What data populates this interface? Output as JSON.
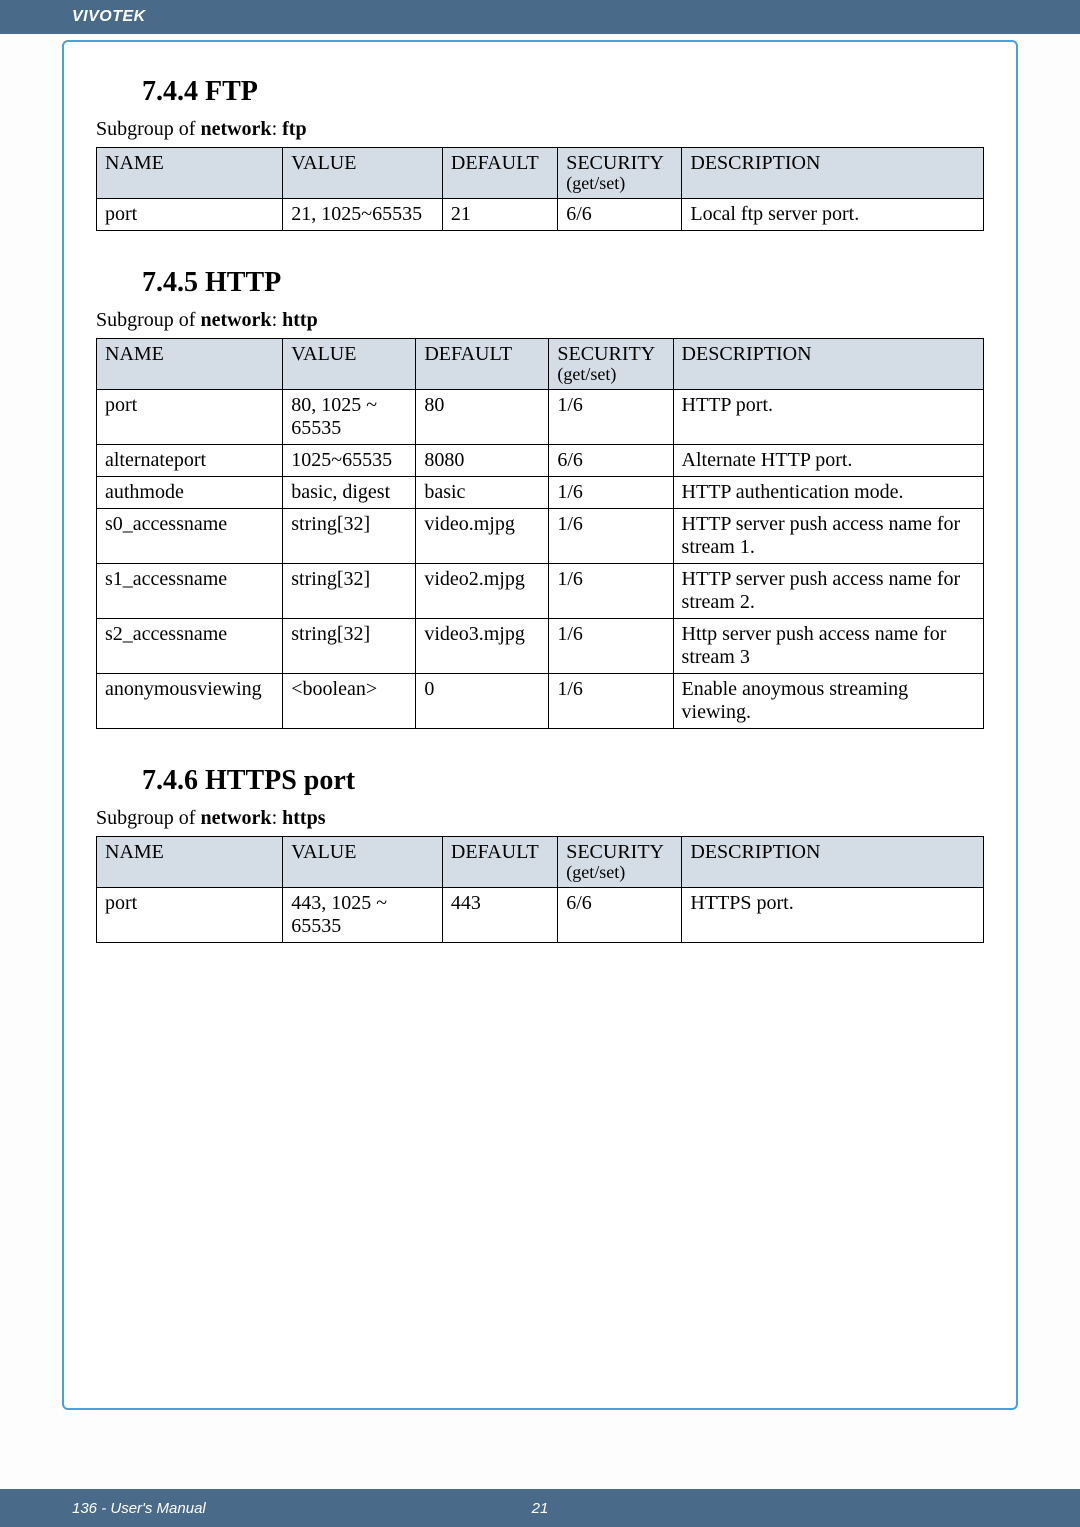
{
  "brand": "VIVOTEK",
  "footer_text": "136 - User's Manual",
  "page_number": "21",
  "ftp": {
    "title": "7.4.4 FTP",
    "subgroup_prefix": "Subgroup of ",
    "subgroup_bold1": "network",
    "subgroup_mid": ": ",
    "subgroup_bold2": "ftp",
    "headers": {
      "name": "NAME",
      "value": "VALUE",
      "default": "DEFAULT",
      "security": "SECURITY",
      "security_sub": "(get/set)",
      "description": "DESCRIPTION"
    },
    "rows": [
      {
        "name": "port",
        "value": "21, 1025~65535",
        "default": "21",
        "security": "6/6",
        "desc": "Local ftp server port."
      }
    ]
  },
  "http": {
    "title": "7.4.5 HTTP",
    "subgroup_prefix": "Subgroup of ",
    "subgroup_bold1": "network",
    "subgroup_mid": ": ",
    "subgroup_bold2": "http",
    "headers": {
      "name": "NAME",
      "value": "VALUE",
      "default": "DEFAULT",
      "security": "SECURITY",
      "security_sub": "(get/set)",
      "description": "DESCRIPTION"
    },
    "rows": [
      {
        "name": "port",
        "value": "80, 1025 ~ 65535",
        "default": "80",
        "security": "1/6",
        "desc": "HTTP port."
      },
      {
        "name": "alternateport",
        "value": "1025~65535",
        "default": "8080",
        "security": "6/6",
        "desc": "Alternate HTTP port."
      },
      {
        "name": "authmode",
        "value": "basic, digest",
        "default": "basic",
        "security": "1/6",
        "desc": "HTTP authentication mode."
      },
      {
        "name": "s0_accessname",
        "value": "string[32]",
        "default": "video.mjpg",
        "security": "1/6",
        "desc": "HTTP server push access name for stream 1."
      },
      {
        "name": "s1_accessname",
        "value": "string[32]",
        "default": "video2.mjpg",
        "security": "1/6",
        "desc": "HTTP server push access name for stream 2."
      },
      {
        "name": "s2_accessname",
        "value": "string[32]",
        "default": "video3.mjpg",
        "security": "1/6",
        "desc": "Http server push access name for stream 3"
      },
      {
        "name": "anonymousviewing",
        "value": "<boolean>",
        "default": "0",
        "security": "1/6",
        "desc": "Enable anoymous streaming viewing."
      }
    ]
  },
  "https": {
    "title": "7.4.6 HTTPS port",
    "subgroup_prefix": "Subgroup of ",
    "subgroup_bold1": "network",
    "subgroup_mid": ": ",
    "subgroup_bold2": "https",
    "headers": {
      "name": "NAME",
      "value": "VALUE",
      "default": "DEFAULT",
      "security": "SECURITY",
      "security_sub": "(get/set)",
      "description": "DESCRIPTION"
    },
    "rows": [
      {
        "name": "port",
        "value": "443, 1025 ~ 65535",
        "default": "443",
        "security": "6/6",
        "desc": "HTTPS port."
      }
    ]
  }
}
